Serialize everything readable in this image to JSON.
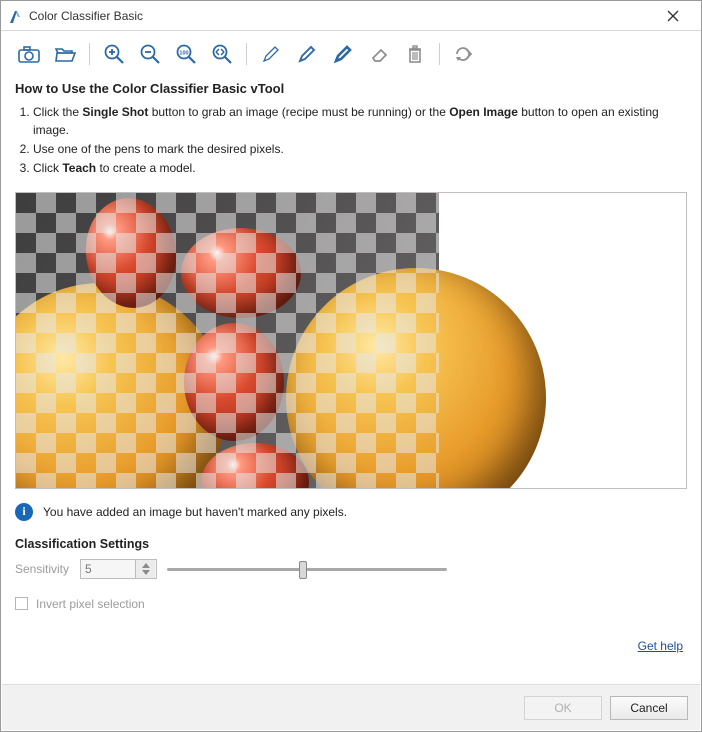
{
  "window": {
    "title": "Color Classifier Basic"
  },
  "toolbar": {
    "camera": "camera-icon",
    "open": "folder-open-icon",
    "zoom_in": "zoom-in-icon",
    "zoom_out": "zoom-out-icon",
    "zoom_100": "zoom-100-icon",
    "zoom_fit": "zoom-fit-icon",
    "pen_small": "pen-small-icon",
    "pen_med": "pen-medium-icon",
    "pen_large": "pen-large-icon",
    "eraser": "eraser-icon",
    "delete": "delete-icon",
    "teach": "teach-icon"
  },
  "instructions": {
    "heading": "How to Use the Color Classifier Basic vTool",
    "step1_a": "Click the ",
    "step1_bold1": "Single Shot",
    "step1_b": " button to grab an image (recipe must be running) or the ",
    "step1_bold2": "Open Image",
    "step1_c": " button to open an existing image.",
    "step2": "Use one of the pens to mark the desired pixels.",
    "step3_a": "Click ",
    "step3_bold": "Teach",
    "step3_b": " to create a model."
  },
  "info": {
    "message": "You have added an image but haven't marked any pixels."
  },
  "settings": {
    "heading": "Classification Settings",
    "sensitivity_label": "Sensitivity",
    "sensitivity_value": "5",
    "slider_value": 5,
    "slider_min": 0,
    "slider_max": 10,
    "invert_label": "Invert pixel selection",
    "invert_checked": false
  },
  "help": {
    "label": "Get help"
  },
  "buttons": {
    "ok": "OK",
    "cancel": "Cancel"
  },
  "colors": {
    "accent": "#2b6aa5",
    "info": "#1a66b7",
    "link": "#1a4f9c"
  }
}
